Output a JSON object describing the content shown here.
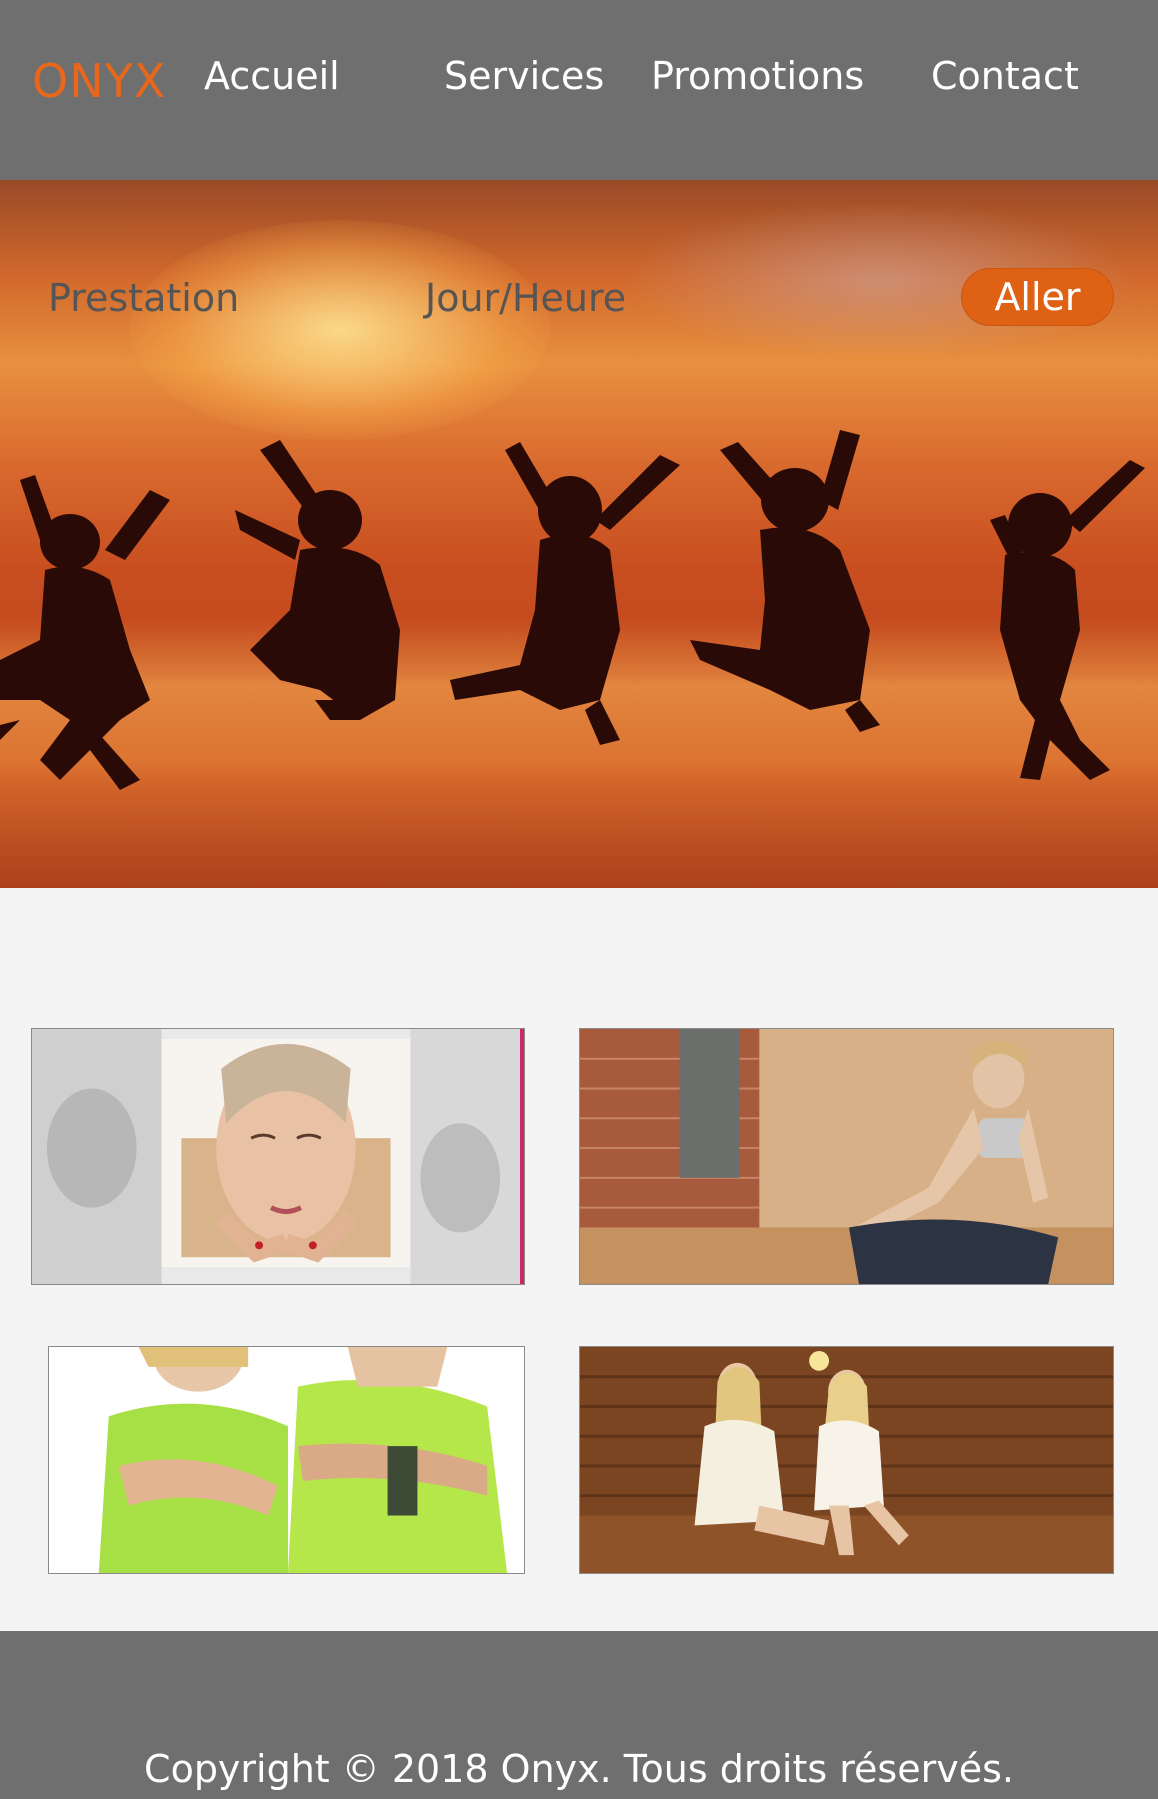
{
  "header": {
    "logo": "ONYX",
    "nav": {
      "home": "Accueil",
      "services": "Services",
      "promotions": "Promotions",
      "contact": "Contact"
    }
  },
  "hero": {
    "fields": {
      "service_label": "Prestation",
      "datetime_label": "Jour/Heure"
    },
    "go_button": "Aller"
  },
  "gallery": {
    "images": [
      "facial-massage-collage",
      "woman-meditating-in-studio",
      "couple-in-green-fitness-shirts",
      "two-women-in-sauna"
    ]
  },
  "footer": {
    "copyright": "Copyright © 2018 Onyx. Tous droits réservés."
  },
  "colors": {
    "accent": "#df6214",
    "logo": "#e8671b",
    "header_bg": "#6f6f6f",
    "page_bg": "#f4f4f4"
  }
}
